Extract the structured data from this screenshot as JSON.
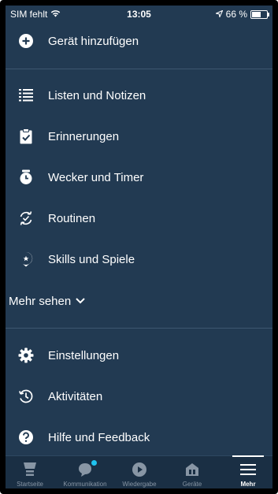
{
  "status_bar": {
    "carrier": "SIM fehlt",
    "time": "13:05",
    "battery": "66 %",
    "battery_level": 0.66
  },
  "menu": {
    "add_device": "Gerät hinzufügen",
    "lists": "Listen und Notizen",
    "reminders": "Erinnerungen",
    "alarms": "Wecker und Timer",
    "routines": "Routinen",
    "skills": "Skills und Spiele",
    "see_more": "Mehr sehen",
    "settings": "Einstellungen",
    "activity": "Aktivitäten",
    "help": "Hilfe und Feedback"
  },
  "tab_bar": {
    "tabs": [
      {
        "label": "Startseite",
        "icon": "home-icon",
        "active": false
      },
      {
        "label": "Kommunikation",
        "icon": "chat-bubble-icon",
        "active": false,
        "badge": true
      },
      {
        "label": "Wiedergabe",
        "icon": "play-icon",
        "active": false
      },
      {
        "label": "Geräte",
        "icon": "devices-home-icon",
        "active": false
      },
      {
        "label": "Mehr",
        "icon": "hamburger-menu-icon",
        "active": true
      }
    ]
  },
  "colors": {
    "background": "#223a52",
    "tab_bar": "#1a2f44",
    "badge": "#1fc3f0",
    "text": "#ffffff"
  }
}
